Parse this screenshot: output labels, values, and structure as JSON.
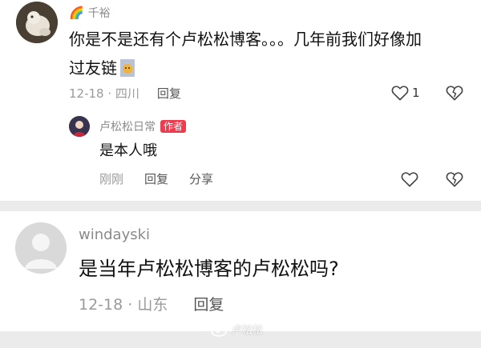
{
  "comments": [
    {
      "username": "千裕",
      "username_emoji": "🌈",
      "text_line1": "你是不是还有个卢松松博客。。。几年前我们好像加",
      "text_line2": "过友链",
      "meta": "12-18 · 四川",
      "reply_label": "回复",
      "like_count": "1",
      "replies": [
        {
          "username": "卢松松日常",
          "badge": "作者",
          "text": "是本人哦",
          "meta": "刚刚",
          "reply_label": "回复",
          "share_label": "分享"
        }
      ]
    },
    {
      "username": "windayski",
      "text": "是当年卢松松博客的卢松松吗?",
      "meta": "12-18 · 山东",
      "reply_label": "回复"
    }
  ],
  "watermark": "卢松松",
  "colors": {
    "author_badge": "#f03a4d",
    "background": "#ebebeb"
  }
}
